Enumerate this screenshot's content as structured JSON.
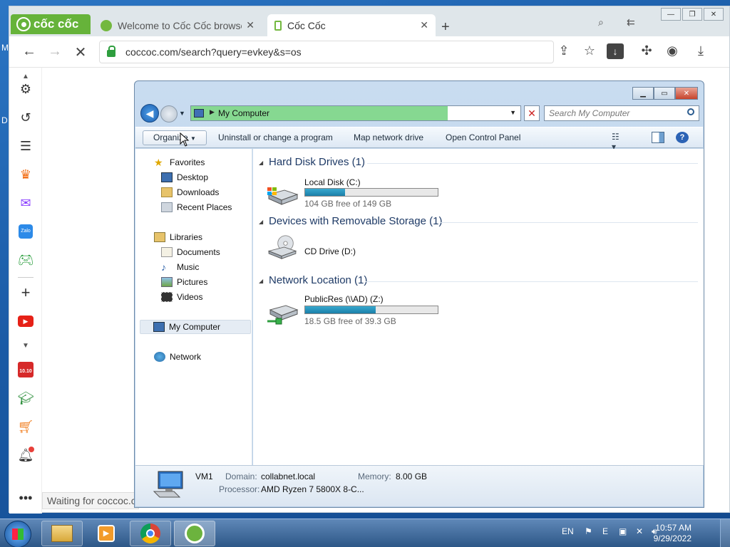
{
  "desktop": {
    "left_letters": [
      "M",
      "D"
    ]
  },
  "browser": {
    "brand": "cốc cốc",
    "tabs": [
      {
        "title": "Welcome to Cốc Cốc browse"
      },
      {
        "title": "Cốc Cốc"
      }
    ],
    "url": "coccoc.com/search?query=evkey&s=os",
    "status": "Waiting for coccoc.c",
    "sidebar_badge": "10.10"
  },
  "explorer": {
    "address": "My Computer",
    "search_placeholder": "Search My Computer",
    "commands": {
      "organize": "Organize",
      "uninstall": "Uninstall or change a program",
      "map_drive": "Map network drive",
      "control_panel": "Open Control Panel"
    },
    "nav": {
      "favorites": "Favorites",
      "desktop": "Desktop",
      "downloads": "Downloads",
      "recent": "Recent Places",
      "libraries": "Libraries",
      "documents": "Documents",
      "music": "Music",
      "pictures": "Pictures",
      "videos": "Videos",
      "my_computer": "My Computer",
      "network": "Network"
    },
    "groups": [
      {
        "title": "Hard Disk Drives (1)"
      },
      {
        "title": "Devices with Removable Storage (1)"
      },
      {
        "title": "Network Location (1)"
      }
    ],
    "drives": [
      {
        "name": "Local Disk (C:)",
        "free": "104 GB free of 149 GB",
        "used_fraction": 0.3
      },
      {
        "name": "CD Drive (D:)"
      },
      {
        "name": "PublicRes (\\\\AD) (Z:)",
        "free": "18.5 GB free of 39.3 GB",
        "used_fraction": 0.53
      }
    ],
    "details": {
      "computer": "VM1",
      "domain_label": "Domain:",
      "domain": "collabnet.local",
      "memory_label": "Memory:",
      "memory": "8.00 GB",
      "processor_label": "Processor:",
      "processor": "AMD Ryzen 7 5800X 8-C..."
    }
  },
  "taskbar": {
    "language": "EN",
    "time": "10:57 AM",
    "date": "9/29/2022"
  }
}
